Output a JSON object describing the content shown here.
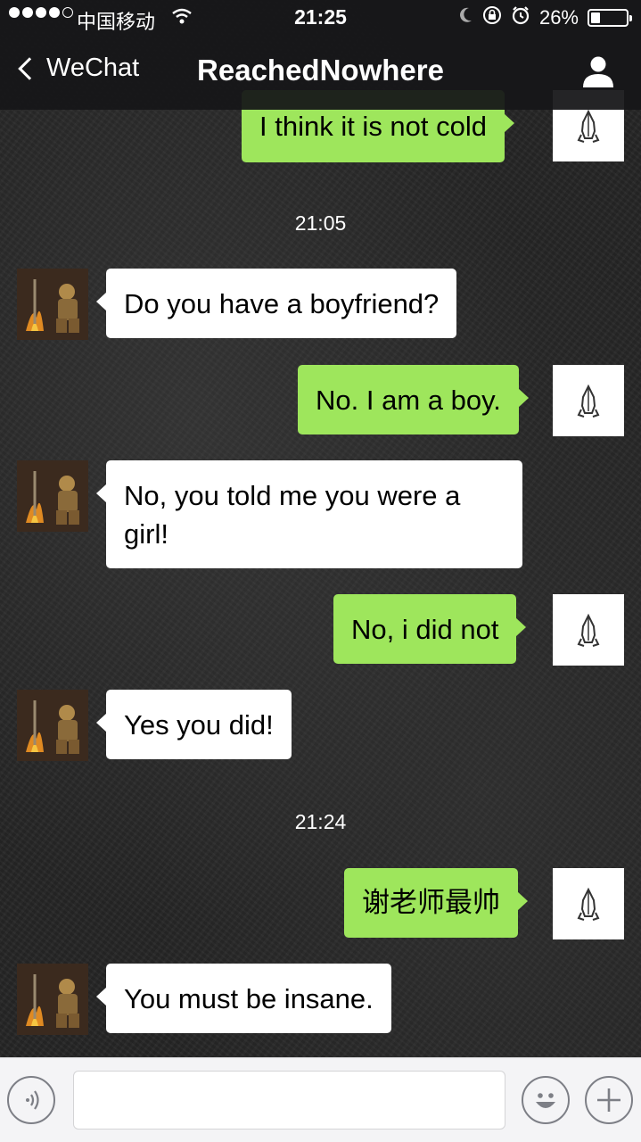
{
  "status_bar": {
    "carrier": "中国移动",
    "time": "21:25",
    "battery_text": "26%",
    "battery_level": 0.26,
    "signal_bars_filled": 4,
    "signal_bars_total": 5
  },
  "nav": {
    "back_label": "WeChat",
    "title": "ReachedNowhere",
    "profile_icon": "person-icon"
  },
  "messages": [
    {
      "type": "out",
      "text": "I think it is not cold"
    },
    {
      "type": "time",
      "text": "21:05"
    },
    {
      "type": "in",
      "text": "Do you have a boyfriend?"
    },
    {
      "type": "out",
      "text": "No. I am a boy."
    },
    {
      "type": "in",
      "text": "No, you told me you were a girl!"
    },
    {
      "type": "out",
      "text": "No, i did not"
    },
    {
      "type": "in",
      "text": "Yes you did!"
    },
    {
      "type": "time",
      "text": "21:24"
    },
    {
      "type": "out",
      "text": "谢老师最帅"
    },
    {
      "type": "in",
      "text": "You must be insane."
    }
  ],
  "input_bar": {
    "text_value": "",
    "voice_icon": "voice-icon",
    "emoji_icon": "emoji-icon",
    "plus_icon": "plus-icon"
  },
  "colors": {
    "outgoing_bubble": "#9ee65c",
    "incoming_bubble": "#ffffff",
    "top_bar": "#161618"
  }
}
